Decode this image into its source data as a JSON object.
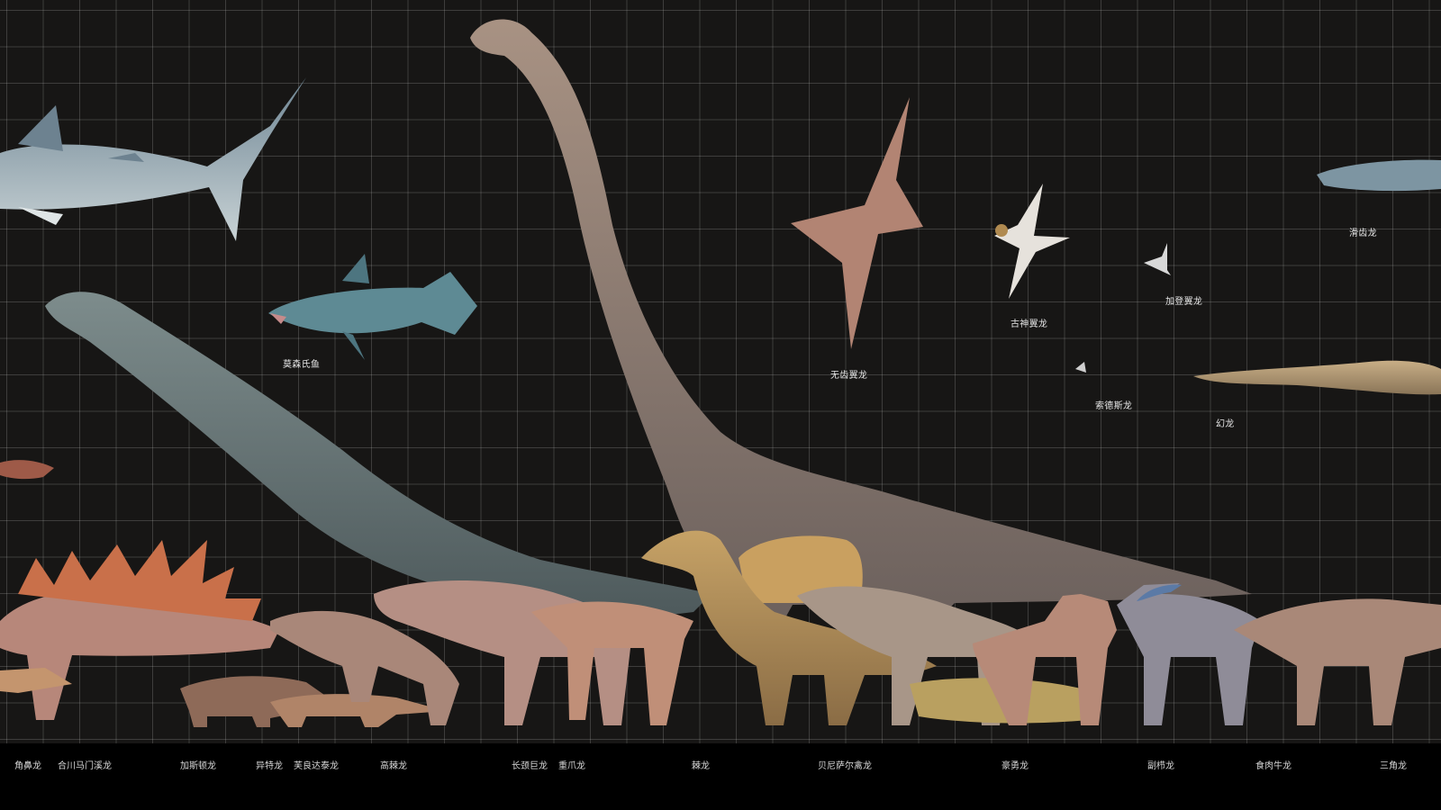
{
  "colors": {
    "background": "#171615",
    "grid_line": "#4a4a4a",
    "ground": "#000000",
    "label_text": "#e6e6e6"
  },
  "labels": {
    "upper": {
      "coelacanth": "莫森氏鱼",
      "quetzalcoatlus": "无齿翼龙",
      "tupandactylus": "古神翼龙",
      "ptero_small_1": "加登翼龙",
      "sordes": "索德斯龙",
      "liopleurodon": "滑齿龙",
      "plesiosaur": "幻龙"
    },
    "bottom": [
      "角鼻龙",
      "合川马门溪龙",
      "加斯顿龙",
      "异特龙",
      "芙良达泰龙",
      "高棘龙",
      "长颈巨龙",
      "重爪龙",
      "棘龙",
      "贝尼萨尔禽龙",
      "豪勇龙",
      "副栉龙",
      "食肉牛龙",
      "三角龙"
    ]
  },
  "icons": [
    "whale-shark-icon",
    "mamenchisaurus-icon",
    "giraffatitan-icon",
    "stegosaurus-icon",
    "spinosaurus-icon",
    "quetzalcoatlus-icon",
    "tupandactylus-icon",
    "coelacanth-icon"
  ]
}
